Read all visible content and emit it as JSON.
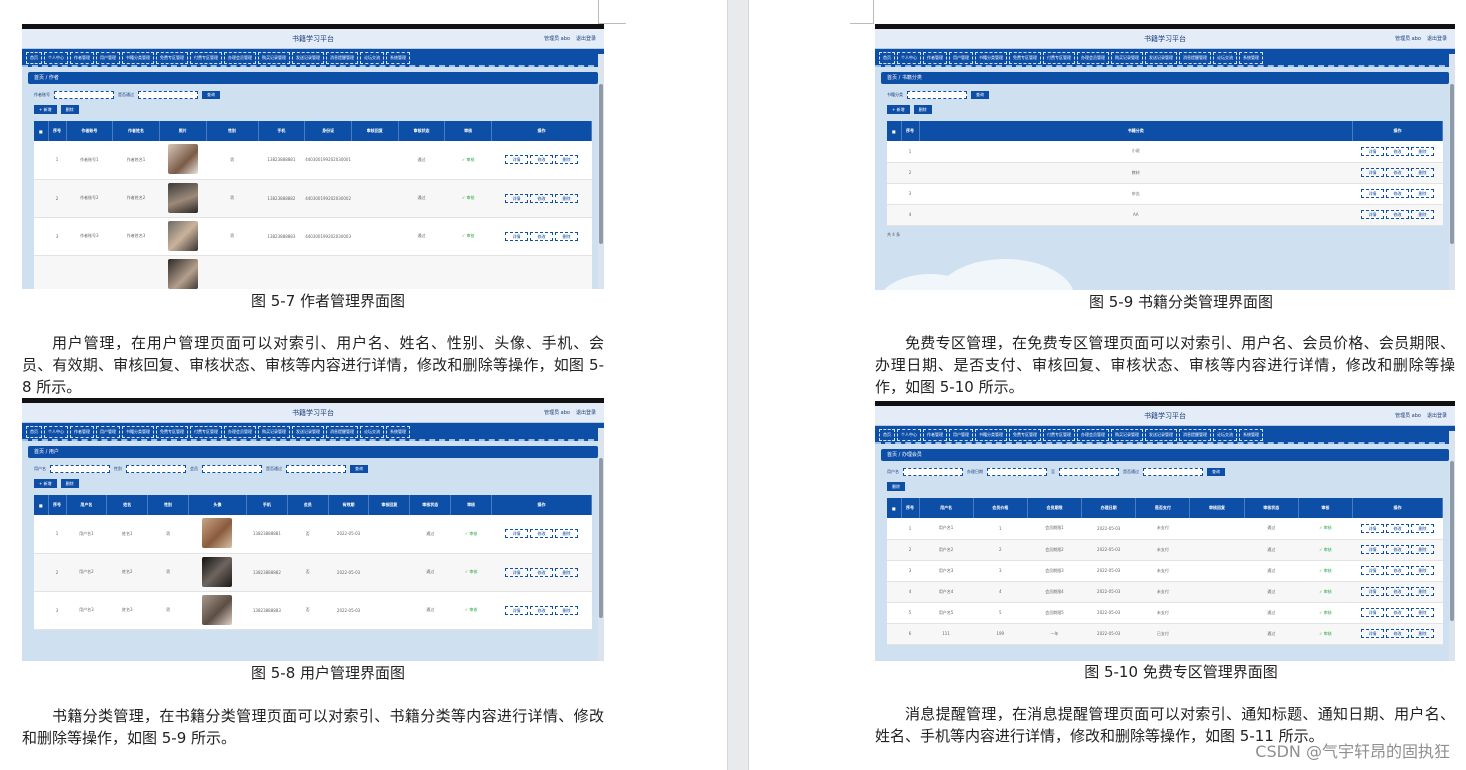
{
  "shared": {
    "platform_title": "书籍学习平台",
    "account": [
      "管理员 abo",
      "退出登录"
    ],
    "menu": [
      "首页",
      "个人中心",
      "作者管理",
      "用户管理",
      "书籍分类管理",
      "免费专区管理",
      "付费专区管理",
      "办理会员管理",
      "购买记录管理",
      "发送记录管理",
      "消息提醒管理",
      "论坛交流",
      "系统管理"
    ],
    "add_label": "+ 新增",
    "delete_label": "删除",
    "search_label": "查询",
    "row_ops": [
      "详情",
      "修改",
      "删除"
    ],
    "approve": "✓ 审核"
  },
  "fig57": {
    "caption": "图 5-7 作者管理界面图",
    "crumb": "首页 / 作者",
    "search_fields": [
      "作者账号",
      "是否通过"
    ],
    "headers": [
      "序号",
      "作者账号",
      "作者姓名",
      "照片",
      "性别",
      "手机",
      "身份证",
      "审核回复",
      "审核状态",
      "审核",
      "操作"
    ],
    "rows": [
      {
        "idx": "1",
        "account": "作者账号1",
        "name": "作者姓名1",
        "gender": "男",
        "phone": "13823888881",
        "id": "440300199202030001",
        "reply": "",
        "status": "通过"
      },
      {
        "idx": "2",
        "account": "作者账号2",
        "name": "作者姓名2",
        "gender": "男",
        "phone": "13823888882",
        "id": "440300199202030002",
        "reply": "",
        "status": "通过"
      },
      {
        "idx": "3",
        "account": "作者账号3",
        "name": "作者姓名3",
        "gender": "男",
        "phone": "13823888883",
        "id": "440300199202030003",
        "reply": "",
        "status": "通过"
      }
    ]
  },
  "para1": "用户管理，在用户管理页面可以对索引、用户名、姓名、性别、头像、手机、会员、有效期、审核回复、审核状态、审核等内容进行详情，修改和删除等操作，如图 5-8 所示。",
  "fig58": {
    "caption": "图 5-8 用户管理界面图",
    "crumb": "首页 / 用户",
    "search_fields": [
      "用户名",
      "性别",
      "会员",
      "是否通过"
    ],
    "headers": [
      "序号",
      "用户名",
      "姓名",
      "性别",
      "头像",
      "手机",
      "会员",
      "有效期",
      "审核回复",
      "审核状态",
      "审核",
      "操作"
    ],
    "rows": [
      {
        "idx": "1",
        "user": "用户名1",
        "name": "姓名1",
        "gender": "男",
        "phone": "13823888881",
        "member": "否",
        "valid": "2022-05-03",
        "reply": "",
        "status": "通过"
      },
      {
        "idx": "2",
        "user": "用户名2",
        "name": "姓名2",
        "gender": "男",
        "phone": "13823888882",
        "member": "否",
        "valid": "2022-05-03",
        "reply": "",
        "status": "通过"
      },
      {
        "idx": "3",
        "user": "用户名3",
        "name": "姓名3",
        "gender": "男",
        "phone": "13823888883",
        "member": "否",
        "valid": "2022-05-03",
        "reply": "",
        "status": "通过"
      }
    ]
  },
  "para2": "书籍分类管理，在书籍分类管理页面可以对索引、书籍分类等内容进行详情、修改和删除等操作，如图 5-9 所示。",
  "fig59": {
    "caption": "图 5-9 书籍分类管理界面图",
    "crumb": "首页 / 书籍分类",
    "search_fields": [
      "书籍分类"
    ],
    "headers": [
      "序号",
      "书籍分类",
      "操作"
    ],
    "rows": [
      {
        "idx": "1",
        "cat": "小说"
      },
      {
        "idx": "2",
        "cat": "教材"
      },
      {
        "idx": "3",
        "cat": "杂志"
      },
      {
        "idx": "4",
        "cat": "AA"
      }
    ],
    "pager": "共 4 条"
  },
  "para3": "免费专区管理，在免费专区管理页面可以对索引、用户名、会员价格、会员期限、办理日期、是否支付、审核回复、审核状态、审核等内容进行详情，修改和删除等操作，如图 5-10 所示。",
  "fig510": {
    "caption": "图 5-10 免费专区管理界面图",
    "crumb": "首页 / 办理会员",
    "search_fields": [
      "用户名",
      "办理日期",
      "至",
      "是否通过"
    ],
    "headers": [
      "序号",
      "用户名",
      "会员价格",
      "会员期限",
      "办理日期",
      "是否支付",
      "审核回复",
      "审核状态",
      "审核",
      "操作"
    ],
    "rows": [
      {
        "idx": "1",
        "user": "用户名1",
        "price": "1",
        "term": "会员期限1",
        "date": "2022-05-03",
        "paid": "未支付",
        "reply": "",
        "status": "通过"
      },
      {
        "idx": "2",
        "user": "用户名2",
        "price": "2",
        "term": "会员期限2",
        "date": "2022-05-03",
        "paid": "未支付",
        "reply": "",
        "status": "通过"
      },
      {
        "idx": "3",
        "user": "用户名3",
        "price": "3",
        "term": "会员期限3",
        "date": "2022-05-03",
        "paid": "未支付",
        "reply": "",
        "status": "通过"
      },
      {
        "idx": "4",
        "user": "用户名4",
        "price": "4",
        "term": "会员期限4",
        "date": "2022-05-03",
        "paid": "未支付",
        "reply": "",
        "status": "通过"
      },
      {
        "idx": "5",
        "user": "用户名5",
        "price": "5",
        "term": "会员期限5",
        "date": "2022-05-03",
        "paid": "未支付",
        "reply": "",
        "status": "通过"
      },
      {
        "idx": "6",
        "user": "111",
        "price": "199",
        "term": "一年",
        "date": "2022-05-03",
        "paid": "已支付",
        "reply": "",
        "status": "通过"
      }
    ]
  },
  "para4": "消息提醒管理，在消息提醒管理页面可以对索引、通知标题、通知日期、用户名、姓名、手机等内容进行详情，修改和删除等操作，如图 5-11 所示。",
  "watermark": "CSDN @气宇轩昂的固执狂"
}
